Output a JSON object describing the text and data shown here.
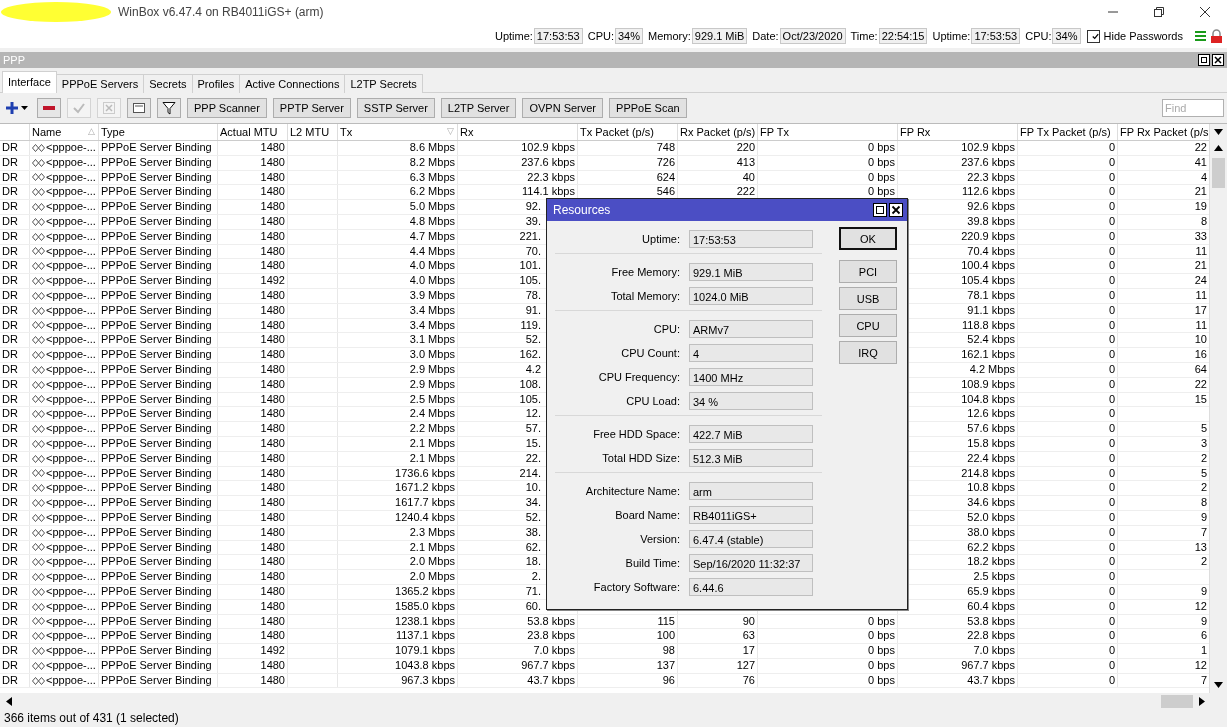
{
  "window": {
    "title": "WinBox v6.47.4 on RB4011iGS+ (arm)"
  },
  "status_items": [
    {
      "label": "Uptime:",
      "value": "17:53:53"
    },
    {
      "label": "CPU:",
      "value": "34%"
    },
    {
      "label": "Memory:",
      "value": "929.1 MiB"
    },
    {
      "label": "Date:",
      "value": "Oct/23/2020"
    },
    {
      "label": "Time:",
      "value": "22:54:15"
    },
    {
      "label": "Uptime:",
      "value": "17:53:53"
    },
    {
      "label": "CPU:",
      "value": "34%"
    }
  ],
  "hide_passwords": {
    "label": "Hide Passwords",
    "checked": true
  },
  "ppp_window": {
    "title": "PPP"
  },
  "tabs": [
    {
      "label": "Interface",
      "selected": true
    },
    {
      "label": "PPPoE Servers",
      "selected": false
    },
    {
      "label": "Secrets",
      "selected": false
    },
    {
      "label": "Profiles",
      "selected": false
    },
    {
      "label": "Active Connections",
      "selected": false
    },
    {
      "label": "L2TP Secrets",
      "selected": false
    }
  ],
  "icon_buttons": [
    {
      "kind": "add",
      "disabled": false
    },
    {
      "kind": "remove",
      "disabled": false
    },
    {
      "kind": "enable",
      "disabled": true
    },
    {
      "kind": "disable",
      "disabled": true
    },
    {
      "kind": "comment",
      "disabled": false
    },
    {
      "kind": "filter",
      "disabled": false
    }
  ],
  "buttons": [
    "PPP Scanner",
    "PPTP Server",
    "SSTP Server",
    "L2TP Server",
    "OVPN Server",
    "PPPoE Scan"
  ],
  "find": {
    "placeholder": "Find"
  },
  "table": {
    "columns": [
      {
        "label": "Name",
        "sort": "△"
      },
      {
        "label": "Type"
      },
      {
        "label": "Actual MTU"
      },
      {
        "label": "L2 MTU"
      },
      {
        "label": "Tx",
        "sort": "▽"
      },
      {
        "label": "Rx"
      },
      {
        "label": "Tx Packet (p/s)"
      },
      {
        "label": "Rx Packet (p/s)"
      },
      {
        "label": "FP Tx"
      },
      {
        "label": "FP Rx"
      },
      {
        "label": "FP Tx Packet (p/s)"
      },
      {
        "label": "FP Rx Packet (p/s"
      }
    ],
    "rows": [
      {
        "flags": "DR",
        "cells": [
          "<pppoe-...",
          "PPPoE Server Binding",
          "1480",
          null,
          "8.6 Mbps",
          "102.9 kbps",
          "748",
          "220",
          "0 bps",
          "102.9 kbps",
          "0",
          "22"
        ]
      },
      {
        "flags": "DR",
        "cells": [
          "<pppoe-...",
          "PPPoE Server Binding",
          "1480",
          null,
          "8.2 Mbps",
          "237.6 kbps",
          "726",
          "413",
          "0 bps",
          "237.6 kbps",
          "0",
          "41"
        ]
      },
      {
        "flags": "DR",
        "cells": [
          "<pppoe-...",
          "PPPoE Server Binding",
          "1480",
          null,
          "6.3 Mbps",
          "22.3 kbps",
          "624",
          "40",
          "0 bps",
          "22.3 kbps",
          "0",
          "4"
        ]
      },
      {
        "flags": "DR",
        "cells": [
          "<pppoe-...",
          "PPPoE Server Binding",
          "1480",
          null,
          "6.2 Mbps",
          "114.1 kbps",
          "546",
          "222",
          "0 bps",
          "112.6 kbps",
          "0",
          "21"
        ]
      },
      {
        "flags": "DR",
        "cells": [
          "<pppoe-...",
          "PPPoE Server Binding",
          "1480",
          null,
          "5.0 Mbps",
          "92.",
          null,
          null,
          null,
          "92.6 kbps",
          "0",
          "19"
        ]
      },
      {
        "flags": "DR",
        "cells": [
          "<pppoe-...",
          "PPPoE Server Binding",
          "1480",
          null,
          "4.8 Mbps",
          "39.",
          null,
          null,
          null,
          "39.8 kbps",
          "0",
          "8"
        ]
      },
      {
        "flags": "DR",
        "cells": [
          "<pppoe-...",
          "PPPoE Server Binding",
          "1480",
          null,
          "4.7 Mbps",
          "221.",
          null,
          null,
          null,
          "220.9 kbps",
          "0",
          "33"
        ]
      },
      {
        "flags": "DR",
        "cells": [
          "<pppoe-...",
          "PPPoE Server Binding",
          "1480",
          null,
          "4.4 Mbps",
          "70.",
          null,
          null,
          null,
          "70.4 kbps",
          "0",
          "11"
        ]
      },
      {
        "flags": "DR",
        "cells": [
          "<pppoe-...",
          "PPPoE Server Binding",
          "1480",
          null,
          "4.0 Mbps",
          "101.",
          null,
          null,
          null,
          "100.4 kbps",
          "0",
          "21"
        ]
      },
      {
        "flags": "DR",
        "cells": [
          "<pppoe-...",
          "PPPoE Server Binding",
          "1492",
          null,
          "4.0 Mbps",
          "105.",
          null,
          null,
          null,
          "105.4 kbps",
          "0",
          "24"
        ]
      },
      {
        "flags": "DR",
        "cells": [
          "<pppoe-...",
          "PPPoE Server Binding",
          "1480",
          null,
          "3.9 Mbps",
          "78.",
          null,
          null,
          null,
          "78.1 kbps",
          "0",
          "11"
        ]
      },
      {
        "flags": "DR",
        "cells": [
          "<pppoe-...",
          "PPPoE Server Binding",
          "1480",
          null,
          "3.4 Mbps",
          "91.",
          null,
          null,
          null,
          "91.1 kbps",
          "0",
          "17"
        ]
      },
      {
        "flags": "DR",
        "cells": [
          "<pppoe-...",
          "PPPoE Server Binding",
          "1480",
          null,
          "3.4 Mbps",
          "119.",
          null,
          null,
          null,
          "118.8 kbps",
          "0",
          "11"
        ]
      },
      {
        "flags": "DR",
        "cells": [
          "<pppoe-...",
          "PPPoE Server Binding",
          "1480",
          null,
          "3.1 Mbps",
          "52.",
          null,
          null,
          null,
          "52.4 kbps",
          "0",
          "10"
        ]
      },
      {
        "flags": "DR",
        "cells": [
          "<pppoe-...",
          "PPPoE Server Binding",
          "1480",
          null,
          "3.0 Mbps",
          "162.",
          null,
          null,
          null,
          "162.1 kbps",
          "0",
          "16"
        ]
      },
      {
        "flags": "DR",
        "cells": [
          "<pppoe-...",
          "PPPoE Server Binding",
          "1480",
          null,
          "2.9 Mbps",
          "4.2",
          null,
          null,
          null,
          "4.2 Mbps",
          "0",
          "64"
        ]
      },
      {
        "flags": "DR",
        "cells": [
          "<pppoe-...",
          "PPPoE Server Binding",
          "1480",
          null,
          "2.9 Mbps",
          "108.",
          null,
          null,
          null,
          "108.9 kbps",
          "0",
          "22"
        ]
      },
      {
        "flags": "DR",
        "cells": [
          "<pppoe-...",
          "PPPoE Server Binding",
          "1480",
          null,
          "2.5 Mbps",
          "105.",
          null,
          null,
          null,
          "104.8 kbps",
          "0",
          "15"
        ]
      },
      {
        "flags": "DR",
        "cells": [
          "<pppoe-...",
          "PPPoE Server Binding",
          "1480",
          null,
          "2.4 Mbps",
          "12.",
          null,
          null,
          null,
          "12.6 kbps",
          "0",
          null
        ]
      },
      {
        "flags": "DR",
        "cells": [
          "<pppoe-...",
          "PPPoE Server Binding",
          "1480",
          null,
          "2.2 Mbps",
          "57.",
          null,
          null,
          null,
          "57.6 kbps",
          "0",
          "5"
        ]
      },
      {
        "flags": "DR",
        "cells": [
          "<pppoe-...",
          "PPPoE Server Binding",
          "1480",
          null,
          "2.1 Mbps",
          "15.",
          null,
          null,
          null,
          "15.8 kbps",
          "0",
          "3"
        ]
      },
      {
        "flags": "DR",
        "cells": [
          "<pppoe-...",
          "PPPoE Server Binding",
          "1480",
          null,
          "2.1 Mbps",
          "22.",
          null,
          null,
          null,
          "22.4 kbps",
          "0",
          "2"
        ]
      },
      {
        "flags": "DR",
        "cells": [
          "<pppoe-...",
          "PPPoE Server Binding",
          "1480",
          null,
          "1736.6 kbps",
          "214.",
          null,
          null,
          null,
          "214.8 kbps",
          "0",
          "5"
        ]
      },
      {
        "flags": "DR",
        "cells": [
          "<pppoe-...",
          "PPPoE Server Binding",
          "1480",
          null,
          "1671.2 kbps",
          "10.",
          null,
          null,
          null,
          "10.8 kbps",
          "0",
          "2"
        ]
      },
      {
        "flags": "DR",
        "cells": [
          "<pppoe-...",
          "PPPoE Server Binding",
          "1480",
          null,
          "1617.7 kbps",
          "34.",
          null,
          null,
          null,
          "34.6 kbps",
          "0",
          "8"
        ]
      },
      {
        "flags": "DR",
        "cells": [
          "<pppoe-...",
          "PPPoE Server Binding",
          "1480",
          null,
          "1240.4 kbps",
          "52.",
          null,
          null,
          null,
          "52.0 kbps",
          "0",
          "9"
        ]
      },
      {
        "flags": "DR",
        "cells": [
          "<pppoe-...",
          "PPPoE Server Binding",
          "1480",
          null,
          "2.3 Mbps",
          "38.",
          null,
          null,
          null,
          "38.0 kbps",
          "0",
          "7"
        ]
      },
      {
        "flags": "DR",
        "cells": [
          "<pppoe-...",
          "PPPoE Server Binding",
          "1480",
          null,
          "2.1 Mbps",
          "62.",
          null,
          null,
          null,
          "62.2 kbps",
          "0",
          "13"
        ]
      },
      {
        "flags": "DR",
        "cells": [
          "<pppoe-...",
          "PPPoE Server Binding",
          "1480",
          null,
          "2.0 Mbps",
          "18.",
          null,
          null,
          null,
          "18.2 kbps",
          "0",
          "2"
        ]
      },
      {
        "flags": "DR",
        "cells": [
          "<pppoe-...",
          "PPPoE Server Binding",
          "1480",
          null,
          "2.0 Mbps",
          "2.",
          null,
          null,
          null,
          "2.5 kbps",
          "0",
          null
        ]
      },
      {
        "flags": "DR",
        "cells": [
          "<pppoe-...",
          "PPPoE Server Binding",
          "1480",
          null,
          "1365.2 kbps",
          "71.",
          null,
          null,
          null,
          "65.9 kbps",
          "0",
          "9"
        ]
      },
      {
        "flags": "DR",
        "cells": [
          "<pppoe-...",
          "PPPoE Server Binding",
          "1480",
          null,
          "1585.0 kbps",
          "60.",
          null,
          null,
          null,
          "60.4 kbps",
          "0",
          "12"
        ]
      },
      {
        "flags": "DR",
        "cells": [
          "<pppoe-...",
          "PPPoE Server Binding",
          "1480",
          null,
          "1238.1 kbps",
          "53.8 kbps",
          "115",
          "90",
          "0 bps",
          "53.8 kbps",
          "0",
          "9"
        ]
      },
      {
        "flags": "DR",
        "cells": [
          "<pppoe-...",
          "PPPoE Server Binding",
          "1480",
          null,
          "1137.1 kbps",
          "23.8 kbps",
          "100",
          "63",
          "0 bps",
          "22.8 kbps",
          "0",
          "6"
        ]
      },
      {
        "flags": "DR",
        "cells": [
          "<pppoe-...",
          "PPPoE Server Binding",
          "1492",
          null,
          "1079.1 kbps",
          "7.0 kbps",
          "98",
          "17",
          "0 bps",
          "7.0 kbps",
          "0",
          "1"
        ]
      },
      {
        "flags": "DR",
        "cells": [
          "<pppoe-...",
          "PPPoE Server Binding",
          "1480",
          null,
          "1043.8 kbps",
          "967.7 kbps",
          "137",
          "127",
          "0 bps",
          "967.7 kbps",
          "0",
          "12"
        ]
      },
      {
        "flags": "DR",
        "cells": [
          "<pppoe-...",
          "PPPoE Server Binding",
          "1480",
          null,
          "967.3 kbps",
          "43.7 kbps",
          "96",
          "76",
          "0 bps",
          "43.7 kbps",
          "0",
          "7"
        ]
      }
    ]
  },
  "status_bar": "366 items out of 431 (1 selected)",
  "resources": {
    "title": "Resources",
    "groups": [
      [
        {
          "label": "Uptime:",
          "value": "17:53:53"
        }
      ],
      [
        {
          "label": "Free Memory:",
          "value": "929.1 MiB"
        },
        {
          "label": "Total Memory:",
          "value": "1024.0 MiB"
        }
      ],
      [
        {
          "label": "CPU:",
          "value": "ARMv7"
        },
        {
          "label": "CPU Count:",
          "value": "4"
        },
        {
          "label": "CPU Frequency:",
          "value": "1400 MHz"
        },
        {
          "label": "CPU Load:",
          "value": "34 %"
        }
      ],
      [
        {
          "label": "Free HDD Space:",
          "value": "422.7 MiB"
        },
        {
          "label": "Total HDD Size:",
          "value": "512.3 MiB"
        }
      ],
      [
        {
          "label": "Architecture Name:",
          "value": "arm"
        },
        {
          "label": "Board Name:",
          "value": "RB4011iGS+"
        },
        {
          "label": "Version:",
          "value": "6.47.4 (stable)"
        },
        {
          "label": "Build Time:",
          "value": "Sep/16/2020 11:32:37"
        },
        {
          "label": "Factory Software:",
          "value": "6.44.6"
        }
      ]
    ],
    "buttons": [
      {
        "label": "OK",
        "focused": true
      },
      {
        "label": "PCI",
        "focused": false
      },
      {
        "label": "USB",
        "focused": false
      },
      {
        "label": "CPU",
        "focused": false
      },
      {
        "label": "IRQ",
        "focused": false
      }
    ]
  }
}
